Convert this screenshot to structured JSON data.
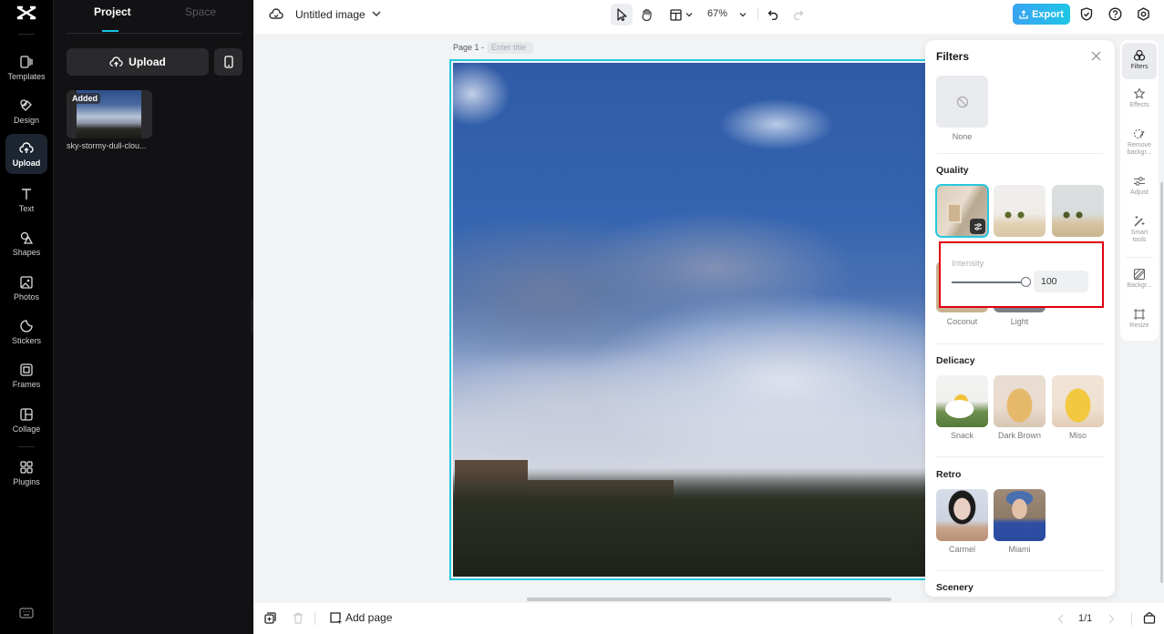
{
  "rail": {
    "items": [
      {
        "label": "Templates",
        "icon": "templates-icon"
      },
      {
        "label": "Design",
        "icon": "design-icon"
      },
      {
        "label": "Upload",
        "icon": "upload-cloud-icon",
        "active": true
      },
      {
        "label": "Text",
        "icon": "text-icon"
      },
      {
        "label": "Shapes",
        "icon": "shapes-icon"
      },
      {
        "label": "Photos",
        "icon": "photos-icon"
      },
      {
        "label": "Stickers",
        "icon": "stickers-icon"
      },
      {
        "label": "Frames",
        "icon": "frames-icon"
      },
      {
        "label": "Collage",
        "icon": "collage-icon"
      },
      {
        "label": "Plugins",
        "icon": "plugins-icon"
      }
    ]
  },
  "panel": {
    "tabs": [
      "Project",
      "Space"
    ],
    "active_tab": "Project",
    "upload_label": "Upload",
    "asset": {
      "badge": "Added",
      "name": "sky-stormy-dull-clou..."
    }
  },
  "topbar": {
    "title": "Untitled image",
    "zoom": "67%",
    "export_label": "Export"
  },
  "canvas": {
    "page_label": "Page 1 -",
    "page_title_placeholder": "Enter title"
  },
  "bottombar": {
    "add_page_label": "Add page",
    "pager": "1/1"
  },
  "filters": {
    "title": "Filters",
    "none_label": "None",
    "sections": [
      {
        "name": "Quality",
        "items": [
          "",
          "",
          ""
        ],
        "hidden_labels": [
          "Coconut",
          "Light"
        ]
      },
      {
        "name": "Delicacy",
        "items": [
          "Snack",
          "Dark Brown",
          "Miso"
        ]
      },
      {
        "name": "Retro",
        "items": [
          "Carmel",
          "Miami"
        ]
      },
      {
        "name": "Scenery",
        "items": []
      }
    ],
    "selected": "Quality/1",
    "intensity": {
      "label": "Intensity",
      "value": "100",
      "fraction": 1.0
    }
  },
  "right_rail": {
    "items": [
      {
        "label": "Filters",
        "active": true
      },
      {
        "label": "Effects"
      },
      {
        "label": "Remove backgr..."
      },
      {
        "label": "Adjust"
      },
      {
        "label": "Smart tools"
      },
      {
        "label": "Backgr..."
      },
      {
        "label": "Resize"
      }
    ]
  }
}
